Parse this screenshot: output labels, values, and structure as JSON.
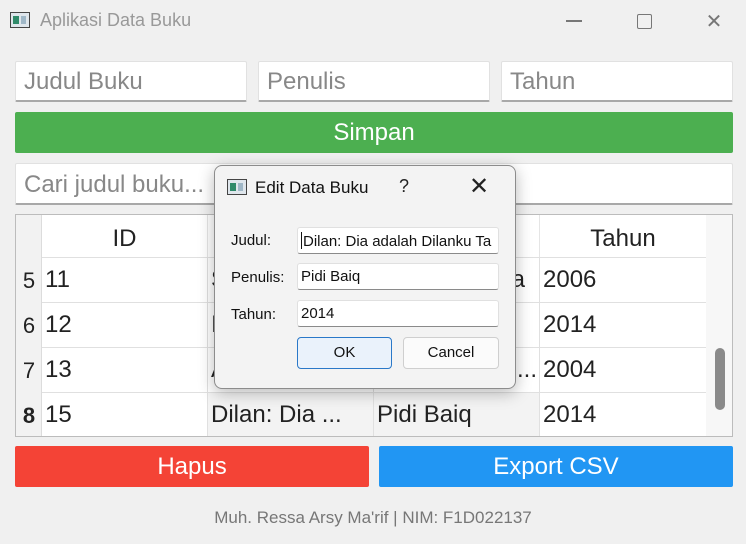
{
  "window": {
    "title": "Aplikasi Data Buku",
    "icon": "app-window-icon",
    "controls": {
      "minimize": "minimize-icon",
      "maximize": "maximize-icon",
      "close": "✕"
    }
  },
  "form": {
    "judul_placeholder": "Judul Buku",
    "penulis_placeholder": "Penulis",
    "tahun_placeholder": "Tahun",
    "save_label": "Simpan",
    "search_placeholder": "Cari judul buku..."
  },
  "table": {
    "headers": [
      "ID",
      "",
      "",
      "Tahun"
    ],
    "rows": [
      {
        "row_num": "5",
        "cells": [
          "11",
          "S",
          "a",
          "2006"
        ]
      },
      {
        "row_num": "6",
        "cells": [
          "12",
          "I",
          "",
          "2014"
        ]
      },
      {
        "row_num": "7",
        "cells": [
          "13",
          "A",
          "...",
          "2004"
        ]
      },
      {
        "row_num": "8",
        "cells": [
          "15",
          "Dilan: Dia ...",
          "Pidi Baiq",
          "2014"
        ]
      }
    ]
  },
  "buttons": {
    "delete_label": "Hapus",
    "export_label": "Export CSV"
  },
  "footer": "Muh. Ressa Arsy Ma'rif | NIM: F1D022137",
  "dialog": {
    "title": "Edit Data Buku",
    "help": "?",
    "close": "✕",
    "judul_label": "Judul:",
    "judul_value": "Dilan: Dia adalah Dilanku Ta",
    "penulis_label": "Penulis:",
    "penulis_value": "Pidi Baiq",
    "tahun_label": "Tahun:",
    "tahun_value": "2014",
    "ok_label": "OK",
    "cancel_label": "Cancel"
  },
  "colors": {
    "save": "#4caf50",
    "delete": "#f44336",
    "export": "#2196f3",
    "ok_border": "#2a78c8"
  }
}
